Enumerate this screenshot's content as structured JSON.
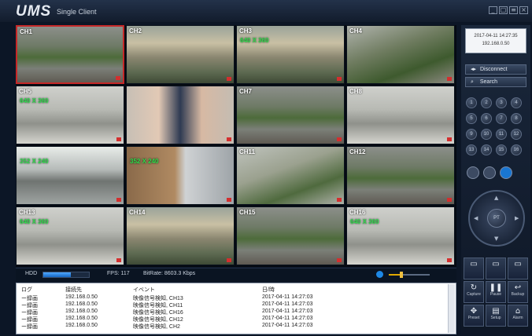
{
  "app": {
    "title": "UMS",
    "subtitle": "Single Client"
  },
  "window_controls": [
    {
      "name": "minimize",
      "glyph": "_"
    },
    {
      "name": "restore",
      "glyph": "▢"
    },
    {
      "name": "settings",
      "glyph": "≡"
    },
    {
      "name": "close",
      "glyph": "×"
    }
  ],
  "channels": [
    {
      "label": "CH1",
      "resolution": "",
      "scene": "stairs-plants",
      "active": true
    },
    {
      "label": "CH2",
      "resolution": "",
      "scene": "courtyard-chairs",
      "active": false
    },
    {
      "label": "CH3",
      "resolution": "640 X 360",
      "scene": "courtyard-chairs",
      "active": false
    },
    {
      "label": "CH4",
      "resolution": "",
      "scene": "courtyard-plants",
      "active": false
    },
    {
      "label": "CH5",
      "resolution": "640 X 360",
      "scene": "boxes",
      "active": false
    },
    {
      "label": "",
      "resolution": "",
      "scene": "people",
      "active": false
    },
    {
      "label": "CH7",
      "resolution": "",
      "scene": "stairs-plants",
      "active": false
    },
    {
      "label": "CH8",
      "resolution": "",
      "scene": "boxes",
      "active": false
    },
    {
      "label": "",
      "resolution": "352 X 240",
      "scene": "street",
      "active": false
    },
    {
      "label": "",
      "resolution": "352 X 240",
      "scene": "door",
      "active": false
    },
    {
      "label": "CH11",
      "resolution": "",
      "scene": "bicycle",
      "active": false
    },
    {
      "label": "CH12",
      "resolution": "",
      "scene": "stairs-plants",
      "active": false
    },
    {
      "label": "CH13",
      "resolution": "640 X 360",
      "scene": "boxes",
      "active": false
    },
    {
      "label": "CH14",
      "resolution": "",
      "scene": "courtyard-chairs",
      "active": false
    },
    {
      "label": "CH15",
      "resolution": "",
      "scene": "stairs-plants",
      "active": false
    },
    {
      "label": "CH16",
      "resolution": "640 X 360",
      "scene": "boxes",
      "active": false
    }
  ],
  "status": {
    "hdd_label": "HDD",
    "hdd_usage": 0.6,
    "fps": "FPS: 117",
    "bitrate": "BitRate: 8603.3 Kbps",
    "volume": 0.3
  },
  "log": {
    "headers": [
      "ログ",
      "接続先",
      "イベント",
      "日/時"
    ],
    "rows": [
      [
        "ー録画",
        "192.168.0.50",
        "映像信号検知, CH13",
        "2017-04-11 14:27:03"
      ],
      [
        "ー録画",
        "192.168.0.50",
        "映像信号検知, CH11",
        "2017-04-11 14:27:03"
      ],
      [
        "ー録画",
        "192.168.0.50",
        "映像信号検知, CH16",
        "2017-04-11 14:27:03"
      ],
      [
        "ー録画",
        "192.168.0.50",
        "映像信号検知, CH12",
        "2017-04-11 14:27:03"
      ],
      [
        "ー録画",
        "192.168.0.50",
        "映像信号検知, CH2",
        "2017-04-11 14:27:03"
      ]
    ]
  },
  "side": {
    "datetime": "2017-04-11 14:27:35",
    "ip": "192.168.0.50",
    "disconnect_label": "Disconnect",
    "search_label": "Search",
    "channel_buttons": [
      "1",
      "2",
      "3",
      "4",
      "5",
      "6",
      "7",
      "8",
      "9",
      "10",
      "11",
      "12",
      "13",
      "14",
      "15",
      "16"
    ],
    "ptz_center": "PT",
    "functions": [
      {
        "icon": "▭",
        "label": ""
      },
      {
        "icon": "▭",
        "label": ""
      },
      {
        "icon": "▭",
        "label": ""
      },
      {
        "icon": "↻",
        "label": "Capture"
      },
      {
        "icon": "❚❚",
        "label": "Pause"
      },
      {
        "icon": "↩",
        "label": "Backup"
      },
      {
        "icon": "✥",
        "label": "Preset"
      },
      {
        "icon": "▤",
        "label": "Setup"
      },
      {
        "icon": "⌂",
        "label": "Alarm"
      }
    ]
  }
}
